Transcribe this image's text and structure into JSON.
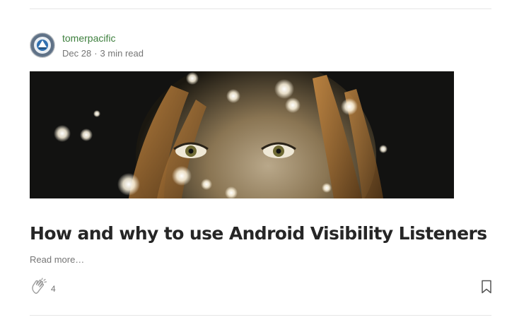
{
  "post": {
    "author": {
      "name": "tomerpacific",
      "avatar_icon": "author-avatar-icon"
    },
    "date": "Dec 28",
    "separator": "·",
    "read_time": "3 min read",
    "hero_image": {
      "icon": "hero-image-eyes-through-lights"
    },
    "title": "How and why to use Android Visibility Listeners",
    "read_more": "Read more…",
    "claps": {
      "icon": "clap-icon",
      "count": "4"
    },
    "bookmark": {
      "icon": "bookmark-icon"
    }
  },
  "colors": {
    "author_name": "#3d7f3d",
    "meta_text": "#757575",
    "title_text": "#262626",
    "divider": "#e6e6e6"
  }
}
